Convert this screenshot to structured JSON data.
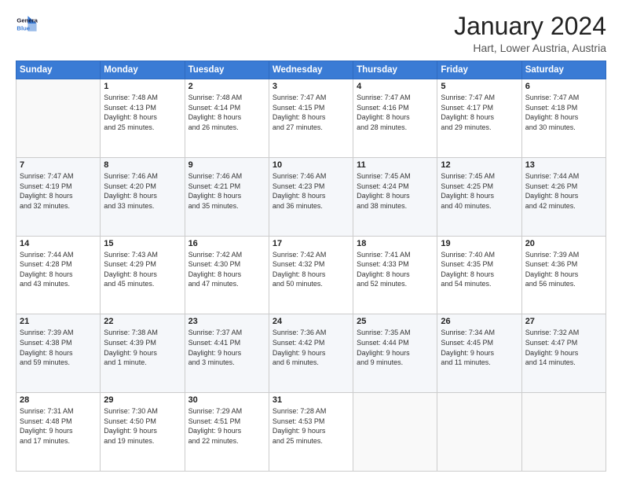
{
  "logo": {
    "line1": "General",
    "line2": "Blue"
  },
  "header": {
    "month": "January 2024",
    "location": "Hart, Lower Austria, Austria"
  },
  "days_of_week": [
    "Sunday",
    "Monday",
    "Tuesday",
    "Wednesday",
    "Thursday",
    "Friday",
    "Saturday"
  ],
  "weeks": [
    [
      {
        "day": "",
        "info": ""
      },
      {
        "day": "1",
        "info": "Sunrise: 7:48 AM\nSunset: 4:13 PM\nDaylight: 8 hours\nand 25 minutes."
      },
      {
        "day": "2",
        "info": "Sunrise: 7:48 AM\nSunset: 4:14 PM\nDaylight: 8 hours\nand 26 minutes."
      },
      {
        "day": "3",
        "info": "Sunrise: 7:47 AM\nSunset: 4:15 PM\nDaylight: 8 hours\nand 27 minutes."
      },
      {
        "day": "4",
        "info": "Sunrise: 7:47 AM\nSunset: 4:16 PM\nDaylight: 8 hours\nand 28 minutes."
      },
      {
        "day": "5",
        "info": "Sunrise: 7:47 AM\nSunset: 4:17 PM\nDaylight: 8 hours\nand 29 minutes."
      },
      {
        "day": "6",
        "info": "Sunrise: 7:47 AM\nSunset: 4:18 PM\nDaylight: 8 hours\nand 30 minutes."
      }
    ],
    [
      {
        "day": "7",
        "info": "Sunrise: 7:47 AM\nSunset: 4:19 PM\nDaylight: 8 hours\nand 32 minutes."
      },
      {
        "day": "8",
        "info": "Sunrise: 7:46 AM\nSunset: 4:20 PM\nDaylight: 8 hours\nand 33 minutes."
      },
      {
        "day": "9",
        "info": "Sunrise: 7:46 AM\nSunset: 4:21 PM\nDaylight: 8 hours\nand 35 minutes."
      },
      {
        "day": "10",
        "info": "Sunrise: 7:46 AM\nSunset: 4:23 PM\nDaylight: 8 hours\nand 36 minutes."
      },
      {
        "day": "11",
        "info": "Sunrise: 7:45 AM\nSunset: 4:24 PM\nDaylight: 8 hours\nand 38 minutes."
      },
      {
        "day": "12",
        "info": "Sunrise: 7:45 AM\nSunset: 4:25 PM\nDaylight: 8 hours\nand 40 minutes."
      },
      {
        "day": "13",
        "info": "Sunrise: 7:44 AM\nSunset: 4:26 PM\nDaylight: 8 hours\nand 42 minutes."
      }
    ],
    [
      {
        "day": "14",
        "info": "Sunrise: 7:44 AM\nSunset: 4:28 PM\nDaylight: 8 hours\nand 43 minutes."
      },
      {
        "day": "15",
        "info": "Sunrise: 7:43 AM\nSunset: 4:29 PM\nDaylight: 8 hours\nand 45 minutes."
      },
      {
        "day": "16",
        "info": "Sunrise: 7:42 AM\nSunset: 4:30 PM\nDaylight: 8 hours\nand 47 minutes."
      },
      {
        "day": "17",
        "info": "Sunrise: 7:42 AM\nSunset: 4:32 PM\nDaylight: 8 hours\nand 50 minutes."
      },
      {
        "day": "18",
        "info": "Sunrise: 7:41 AM\nSunset: 4:33 PM\nDaylight: 8 hours\nand 52 minutes."
      },
      {
        "day": "19",
        "info": "Sunrise: 7:40 AM\nSunset: 4:35 PM\nDaylight: 8 hours\nand 54 minutes."
      },
      {
        "day": "20",
        "info": "Sunrise: 7:39 AM\nSunset: 4:36 PM\nDaylight: 8 hours\nand 56 minutes."
      }
    ],
    [
      {
        "day": "21",
        "info": "Sunrise: 7:39 AM\nSunset: 4:38 PM\nDaylight: 8 hours\nand 59 minutes."
      },
      {
        "day": "22",
        "info": "Sunrise: 7:38 AM\nSunset: 4:39 PM\nDaylight: 9 hours\nand 1 minute."
      },
      {
        "day": "23",
        "info": "Sunrise: 7:37 AM\nSunset: 4:41 PM\nDaylight: 9 hours\nand 3 minutes."
      },
      {
        "day": "24",
        "info": "Sunrise: 7:36 AM\nSunset: 4:42 PM\nDaylight: 9 hours\nand 6 minutes."
      },
      {
        "day": "25",
        "info": "Sunrise: 7:35 AM\nSunset: 4:44 PM\nDaylight: 9 hours\nand 9 minutes."
      },
      {
        "day": "26",
        "info": "Sunrise: 7:34 AM\nSunset: 4:45 PM\nDaylight: 9 hours\nand 11 minutes."
      },
      {
        "day": "27",
        "info": "Sunrise: 7:32 AM\nSunset: 4:47 PM\nDaylight: 9 hours\nand 14 minutes."
      }
    ],
    [
      {
        "day": "28",
        "info": "Sunrise: 7:31 AM\nSunset: 4:48 PM\nDaylight: 9 hours\nand 17 minutes."
      },
      {
        "day": "29",
        "info": "Sunrise: 7:30 AM\nSunset: 4:50 PM\nDaylight: 9 hours\nand 19 minutes."
      },
      {
        "day": "30",
        "info": "Sunrise: 7:29 AM\nSunset: 4:51 PM\nDaylight: 9 hours\nand 22 minutes."
      },
      {
        "day": "31",
        "info": "Sunrise: 7:28 AM\nSunset: 4:53 PM\nDaylight: 9 hours\nand 25 minutes."
      },
      {
        "day": "",
        "info": ""
      },
      {
        "day": "",
        "info": ""
      },
      {
        "day": "",
        "info": ""
      }
    ]
  ]
}
